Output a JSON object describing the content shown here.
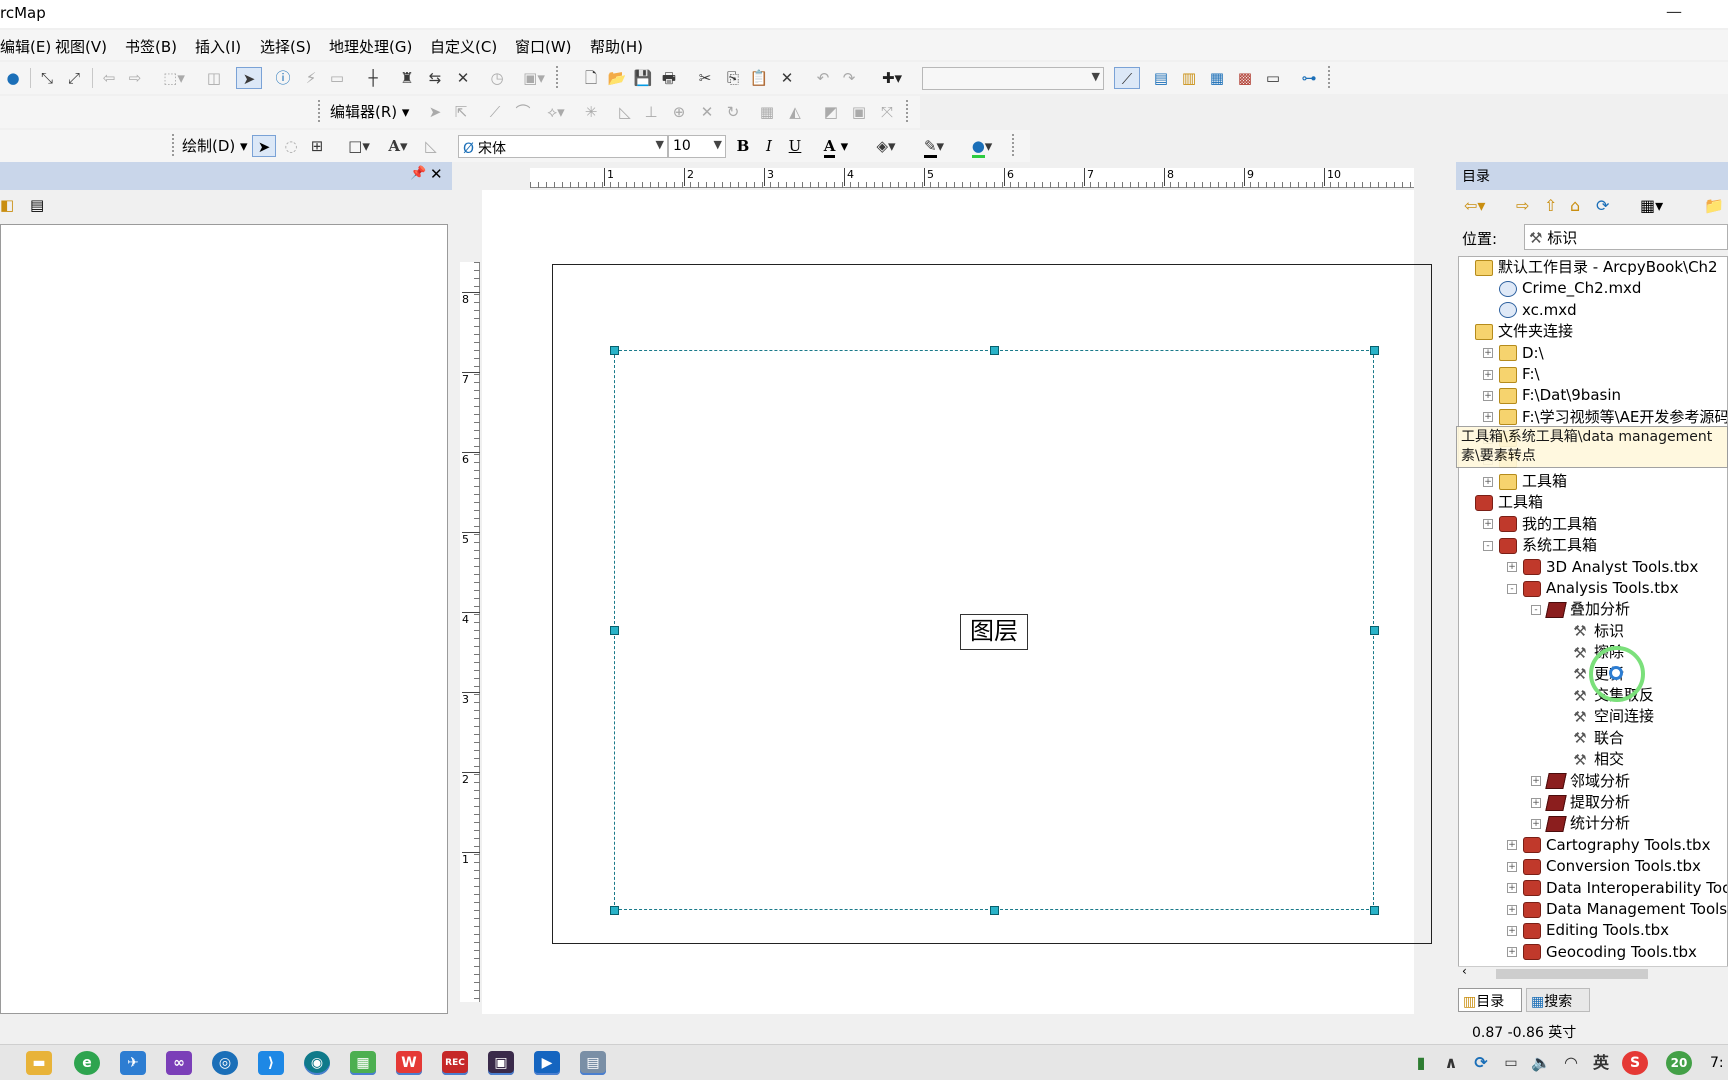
{
  "window": {
    "title": "ArcMap",
    "title_visible": "rcMap",
    "minimize_symbol": "—"
  },
  "menubar": [
    "编辑(E)",
    "视图(V)",
    "书签(B)",
    "插入(I)",
    "选择(S)",
    "地理处理(G)",
    "自定义(C)",
    "窗口(W)",
    "帮助(H)"
  ],
  "editor_toolbar": {
    "label": "编辑器(R)"
  },
  "draw_toolbar": {
    "label": "绘制(D)",
    "font_name": "宋体",
    "font_size": "10",
    "bold": "B",
    "italic": "I",
    "underline": "U",
    "font_color_letter": "A"
  },
  "scale_combo": {
    "value": ""
  },
  "layout": {
    "h_ruler_ticks": [
      "1",
      "2",
      "3",
      "4",
      "5",
      "6",
      "7",
      "8",
      "9",
      "10"
    ],
    "v_ruler_ticks": [
      "8",
      "7",
      "6",
      "5",
      "4",
      "3",
      "2",
      "1"
    ],
    "data_frame_label": "图层"
  },
  "catalog": {
    "title": "目录",
    "location_label": "位置:",
    "location_value": "标识",
    "tooltip_line1": "工具箱\\系统工具箱\\data management",
    "tooltip_line2": "素\\要素转点",
    "tree": [
      {
        "label": "默认工作目录 - ArcpyBook\\Ch2",
        "level": 0,
        "icon": "folder",
        "expander": ""
      },
      {
        "label": "Crime_Ch2.mxd",
        "level": 1,
        "icon": "mxd",
        "expander": ""
      },
      {
        "label": "xc.mxd",
        "level": 1,
        "icon": "mxd",
        "expander": ""
      },
      {
        "label": "文件夹连接",
        "level": 0,
        "icon": "folder",
        "expander": ""
      },
      {
        "label": "D:\\",
        "level": 1,
        "icon": "folder",
        "expander": "+"
      },
      {
        "label": "F:\\",
        "level": 1,
        "icon": "folder",
        "expander": "+"
      },
      {
        "label": "F:\\Dat\\9basin",
        "level": 1,
        "icon": "folder",
        "expander": "+"
      },
      {
        "label": "F:\\学习视频等\\AE开发参考源码\\FC",
        "level": 1,
        "icon": "folder",
        "expander": "+"
      },
      {
        "label": "",
        "level": 1,
        "icon": "folder",
        "expander": "+"
      },
      {
        "label": "",
        "level": 1,
        "icon": "folder",
        "expander": "+"
      },
      {
        "label": "工具箱",
        "level": 1,
        "icon": "folder",
        "expander": "+"
      },
      {
        "label": "工具箱",
        "level": 0,
        "icon": "tbx",
        "expander": ""
      },
      {
        "label": "我的工具箱",
        "level": 1,
        "icon": "tbx",
        "expander": "+"
      },
      {
        "label": "系统工具箱",
        "level": 1,
        "icon": "tbx",
        "expander": "-"
      },
      {
        "label": "3D Analyst Tools.tbx",
        "level": 2,
        "icon": "tbx",
        "expander": "+"
      },
      {
        "label": "Analysis Tools.tbx",
        "level": 2,
        "icon": "tbx",
        "expander": "-"
      },
      {
        "label": "叠加分析",
        "level": 3,
        "icon": "set",
        "expander": "-"
      },
      {
        "label": "标识",
        "level": 4,
        "icon": "tool",
        "expander": ""
      },
      {
        "label": "擦除",
        "level": 4,
        "icon": "tool",
        "expander": ""
      },
      {
        "label": "更新",
        "level": 4,
        "icon": "tool",
        "expander": ""
      },
      {
        "label": "交集取反",
        "level": 4,
        "icon": "tool",
        "expander": ""
      },
      {
        "label": "空间连接",
        "level": 4,
        "icon": "tool",
        "expander": ""
      },
      {
        "label": "联合",
        "level": 4,
        "icon": "tool",
        "expander": ""
      },
      {
        "label": "相交",
        "level": 4,
        "icon": "tool",
        "expander": ""
      },
      {
        "label": "邻域分析",
        "level": 3,
        "icon": "set",
        "expander": "+"
      },
      {
        "label": "提取分析",
        "level": 3,
        "icon": "set",
        "expander": "+"
      },
      {
        "label": "统计分析",
        "level": 3,
        "icon": "set",
        "expander": "+"
      },
      {
        "label": "Cartography Tools.tbx",
        "level": 2,
        "icon": "tbx",
        "expander": "+"
      },
      {
        "label": "Conversion Tools.tbx",
        "level": 2,
        "icon": "tbx",
        "expander": "+"
      },
      {
        "label": "Data Interoperability Tools.t",
        "level": 2,
        "icon": "tbx",
        "expander": "+"
      },
      {
        "label": "Data Management Tools.tbx",
        "level": 2,
        "icon": "tbx",
        "expander": "+"
      },
      {
        "label": "Editing Tools.tbx",
        "level": 2,
        "icon": "tbx",
        "expander": "+"
      },
      {
        "label": "Geocoding Tools.tbx",
        "level": 2,
        "icon": "tbx",
        "expander": "+"
      }
    ],
    "tabs": [
      "目录",
      "搜索"
    ]
  },
  "status": {
    "coordinates": "0.87  -0.86 英寸"
  },
  "taskbar": {
    "clock": "7:",
    "badge": "20"
  }
}
